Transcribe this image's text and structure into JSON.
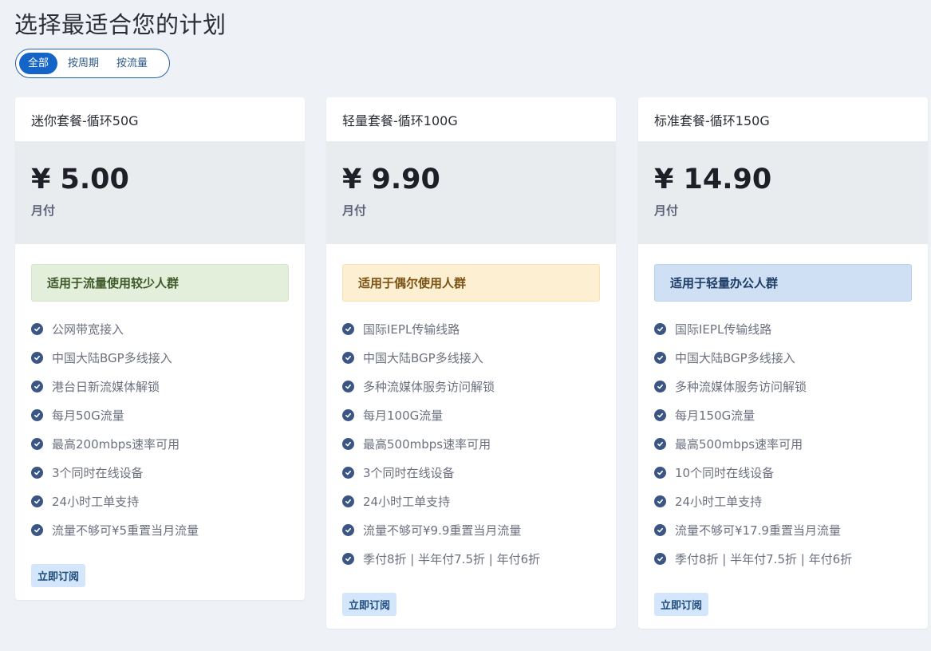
{
  "page": {
    "title": "选择最适合您的计划"
  },
  "filters": [
    {
      "label": "全部",
      "active": true
    },
    {
      "label": "按周期",
      "active": false
    },
    {
      "label": "按流量",
      "active": false
    }
  ],
  "plans": [
    {
      "name": "迷你套餐-循环50G",
      "price": "¥ 5.00",
      "period": "月付",
      "audience": "适用于流量使用较少人群",
      "features": [
        "公网带宽接入",
        "中国大陆BGP多线接入",
        "港台日新流媒体解锁",
        "每月50G流量",
        "最高200mbps速率可用",
        "3个同时在线设备",
        "24小时工单支持",
        "流量不够可¥5重置当月流量"
      ],
      "cta": "立即订阅"
    },
    {
      "name": "轻量套餐-循环100G",
      "price": "¥ 9.90",
      "period": "月付",
      "audience": "适用于偶尔使用人群",
      "features": [
        "国际IEPL传输线路",
        "中国大陆BGP多线接入",
        "多种流媒体服务访问解锁",
        "每月100G流量",
        "最高500mbps速率可用",
        "3个同时在线设备",
        "24小时工单支持",
        "流量不够可¥9.9重置当月流量",
        "季付8折 | 半年付7.5折 | 年付6折"
      ],
      "cta": "立即订阅"
    },
    {
      "name": "标准套餐-循环150G",
      "price": "¥ 14.90",
      "period": "月付",
      "audience": "适用于轻量办公人群",
      "features": [
        "国际IEPL传输线路",
        "中国大陆BGP多线接入",
        "多种流媒体服务访问解锁",
        "每月150G流量",
        "最高500mbps速率可用",
        "10个同时在线设备",
        "24小时工单支持",
        "流量不够可¥17.9重置当月流量",
        "季付8折 | 半年付7.5折 | 年付6折"
      ],
      "cta": "立即订阅"
    }
  ],
  "colors": {
    "accent": "#1565c8",
    "check": "#3b5584",
    "audience_green": "#e3eedb",
    "audience_yellow": "#fdefd1",
    "audience_blue": "#cfe0f5"
  }
}
